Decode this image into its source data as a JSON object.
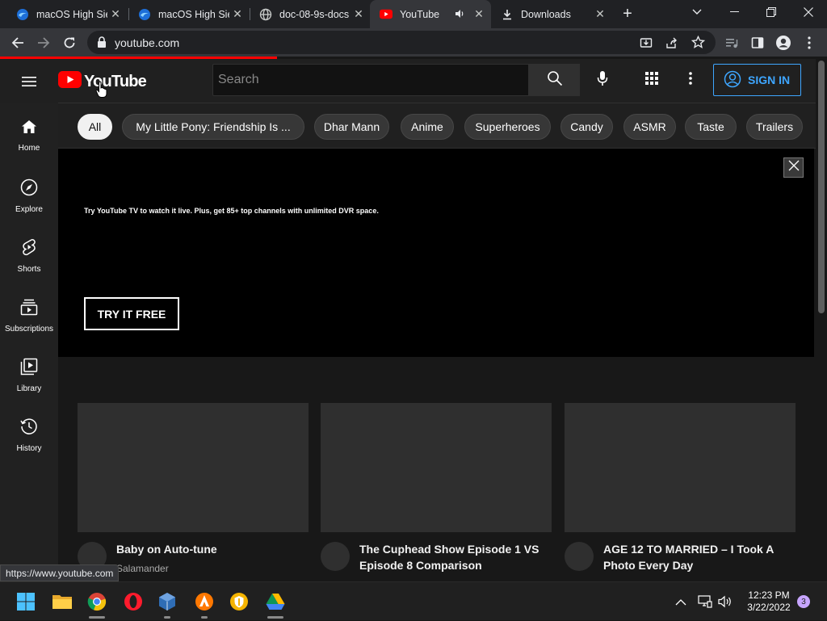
{
  "browser": {
    "tabs": [
      {
        "label": "macOS High Sie",
        "favicon": "edge-wave-icon",
        "active": false
      },
      {
        "label": "macOS High Sie",
        "favicon": "edge-wave-icon",
        "active": false
      },
      {
        "label": "doc-08-9s-docs",
        "favicon": "globe-icon",
        "active": false
      },
      {
        "label": "YouTube",
        "favicon": "youtube-icon",
        "active": true,
        "audio": true
      },
      {
        "label": "Downloads",
        "favicon": "download-icon",
        "active": false
      }
    ],
    "url": "youtube.com",
    "status_url": "https://www.youtube.com",
    "page_load_progress": 0.335
  },
  "youtube": {
    "logo_text": "YouTube",
    "search_placeholder": "Search",
    "sign_in_label": "SIGN IN",
    "sidebar": [
      {
        "label": "Home",
        "icon": "home-icon"
      },
      {
        "label": "Explore",
        "icon": "compass-icon"
      },
      {
        "label": "Shorts",
        "icon": "shorts-icon"
      },
      {
        "label": "Subscriptions",
        "icon": "subscriptions-icon"
      },
      {
        "label": "Library",
        "icon": "library-icon"
      },
      {
        "label": "History",
        "icon": "history-icon"
      }
    ],
    "chips": [
      {
        "label": "All",
        "selected": true
      },
      {
        "label": "My Little Pony: Friendship Is ...",
        "selected": false
      },
      {
        "label": "Dhar Mann",
        "selected": false
      },
      {
        "label": "Anime",
        "selected": false
      },
      {
        "label": "Superheroes",
        "selected": false
      },
      {
        "label": "Candy",
        "selected": false
      },
      {
        "label": "ASMR",
        "selected": false
      },
      {
        "label": "Taste",
        "selected": false
      },
      {
        "label": "Trailers",
        "selected": false
      }
    ],
    "banner": {
      "text": "Try YouTube TV to watch it live. Plus, get 85+ top channels with unlimited DVR space.",
      "cta": "TRY IT FREE"
    },
    "videos": [
      {
        "title": "Baby on Auto-tune",
        "channel": "Salamander"
      },
      {
        "title": "The Cuphead Show Episode 1 VS Episode 8 Comparison",
        "channel": ""
      },
      {
        "title": "AGE 12 TO MARRIED – I Took A Photo Every Day",
        "channel": ""
      }
    ]
  },
  "taskbar": {
    "apps": [
      "windows-start-icon",
      "file-explorer-icon",
      "chrome-icon",
      "opera-icon",
      "virtualbox-icon",
      "avast-icon",
      "vpn-shield-icon",
      "google-drive-icon"
    ],
    "time": "12:23 PM",
    "date": "3/22/2022",
    "notification_count": "3"
  },
  "colors": {
    "youtube_red": "#ff0000",
    "signin_blue": "#3ea6ff",
    "page_bg": "#181818",
    "masthead_bg": "#202020"
  }
}
